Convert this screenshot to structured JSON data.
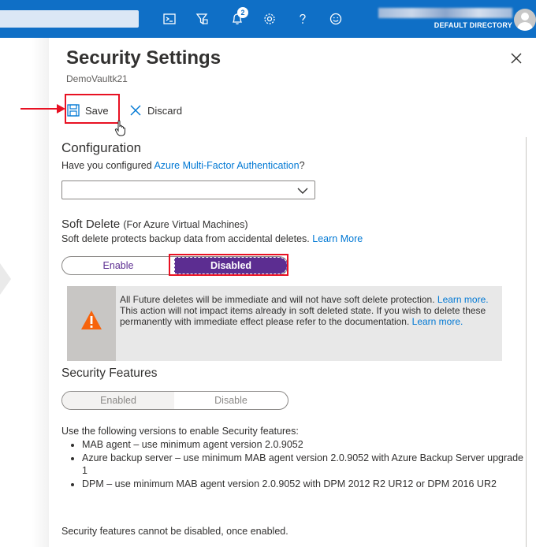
{
  "topbar": {
    "notification_count": "2",
    "directory": "DEFAULT DIRECTORY",
    "icons": [
      "cloud-shell-icon",
      "directory-filter-icon",
      "notifications-icon",
      "settings-icon",
      "help-icon",
      "feedback-icon"
    ]
  },
  "blade": {
    "title": "Security Settings",
    "subtitle": "DemoVaultk21"
  },
  "commands": {
    "save_label": "Save",
    "discard_label": "Discard"
  },
  "configuration": {
    "heading": "Configuration",
    "question_prefix": "Have you configured ",
    "question_link": "Azure Multi-Factor Authentication",
    "question_suffix": "?",
    "dropdown_value": ""
  },
  "soft_delete": {
    "heading": "Soft Delete",
    "heading_note": "(For Azure Virtual Machines)",
    "description": "Soft delete protects backup data from accidental deletes.",
    "learn_more": "Learn More",
    "option_enable": "Enable",
    "option_disabled": "Disabled",
    "selected": "Disabled"
  },
  "warning": {
    "line1": "All Future deletes will be immediate and will not have soft delete protection.",
    "line1_link": "Learn more.",
    "line2": "This action will not impact items already in soft deleted state. If you wish to delete these permanently with immediate effect please refer to the documentation.",
    "line2_link": "Learn more."
  },
  "security_features": {
    "heading": "Security Features",
    "option_enabled": "Enabled",
    "option_disable": "Disable",
    "selected": "Enabled",
    "intro": "Use the following versions to enable Security features:",
    "requirements": [
      "MAB agent – use minimum agent version 2.0.9052",
      "Azure backup server – use minimum MAB agent version 2.0.9052 with Azure Backup Server upgrade 1",
      "DPM – use minimum MAB agent version 2.0.9052 with DPM 2012 R2 UR12 or DPM 2016 UR2"
    ],
    "note": "Security features cannot be disabled, once enabled."
  },
  "colors": {
    "topbar": "#0f6fc6",
    "link": "#0078d4",
    "toggle_selected": "#5c2d91",
    "highlight": "#e81123",
    "warning_icon": "#f7630c"
  }
}
